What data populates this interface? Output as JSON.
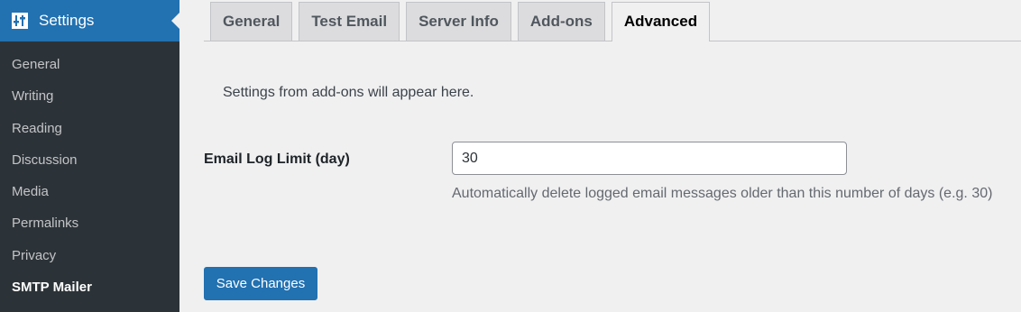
{
  "sidebar": {
    "header": {
      "label": "Settings",
      "icon": "settings-sliders-icon"
    },
    "items": [
      {
        "label": "General",
        "current": false
      },
      {
        "label": "Writing",
        "current": false
      },
      {
        "label": "Reading",
        "current": false
      },
      {
        "label": "Discussion",
        "current": false
      },
      {
        "label": "Media",
        "current": false
      },
      {
        "label": "Permalinks",
        "current": false
      },
      {
        "label": "Privacy",
        "current": false
      },
      {
        "label": "SMTP Mailer",
        "current": true
      }
    ]
  },
  "tabs": [
    {
      "label": "General",
      "active": false
    },
    {
      "label": "Test Email",
      "active": false
    },
    {
      "label": "Server Info",
      "active": false
    },
    {
      "label": "Add-ons",
      "active": false
    },
    {
      "label": "Advanced",
      "active": true
    }
  ],
  "main": {
    "notice": "Settings from add-ons will appear here.",
    "field_label": "Email Log Limit (day)",
    "field_value": "30",
    "description": "Automatically delete logged email messages older than this number of days (e.g. 30)",
    "save_label": "Save Changes"
  },
  "colors": {
    "accent": "#2271b1",
    "sidebar_bg": "#2c3338",
    "page_bg": "#f0f0f1"
  }
}
